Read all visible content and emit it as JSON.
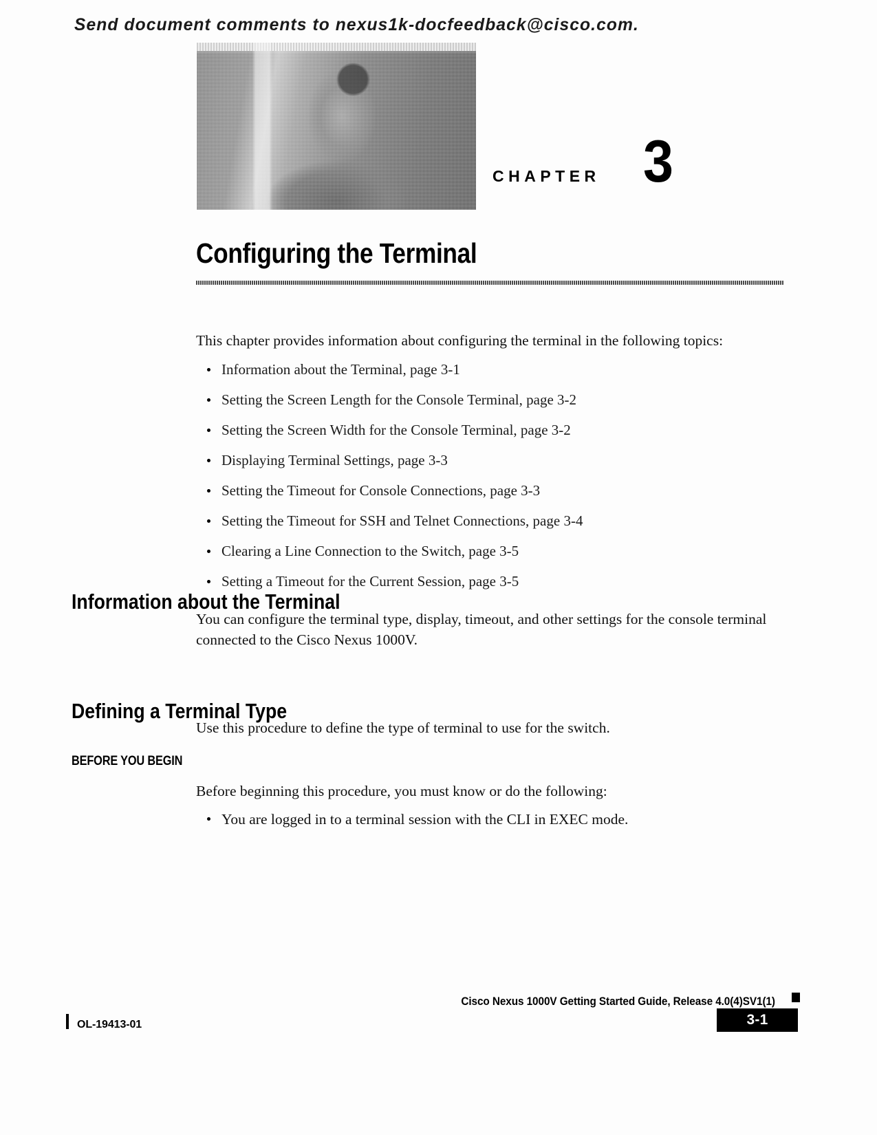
{
  "header": {
    "feedback_line": "Send document comments to nexus1k-docfeedback@cisco.com."
  },
  "chapter": {
    "label": "CHAPTER",
    "number": "3",
    "title": "Configuring the Terminal"
  },
  "intro": {
    "lead": "This chapter provides information about configuring the terminal in the following topics:",
    "topics": [
      "Information about the Terminal, page 3-1",
      "Setting the Screen Length for the Console Terminal, page 3-2",
      "Setting the Screen Width for the Console Terminal, page 3-2",
      "Displaying Terminal Settings, page 3-3",
      "Setting the Timeout for Console Connections, page 3-3",
      "Setting the Timeout for SSH and Telnet Connections, page 3-4",
      "Clearing a Line Connection to the Switch, page 3-5",
      "Setting a Timeout for the Current Session, page 3-5"
    ]
  },
  "sections": [
    {
      "heading": "Information about the Terminal",
      "body": "You can configure the terminal type, display, timeout, and other settings for the console terminal connected to the Cisco Nexus 1000V."
    },
    {
      "heading": "Defining a Terminal Type",
      "body": "Use this procedure to define the type of terminal to use for the switch.",
      "subhead": "BEFORE YOU BEGIN",
      "before_intro": "Before beginning this procedure, you must know or do the following:",
      "before_items": [
        "You are logged in to a terminal session with the CLI in EXEC mode."
      ]
    }
  ],
  "footer": {
    "guide_title": "Cisco Nexus 1000V Getting Started Guide, Release 4.0(4)SV1(1)",
    "doc_id": "OL-19413-01",
    "page_number": "3-1"
  }
}
